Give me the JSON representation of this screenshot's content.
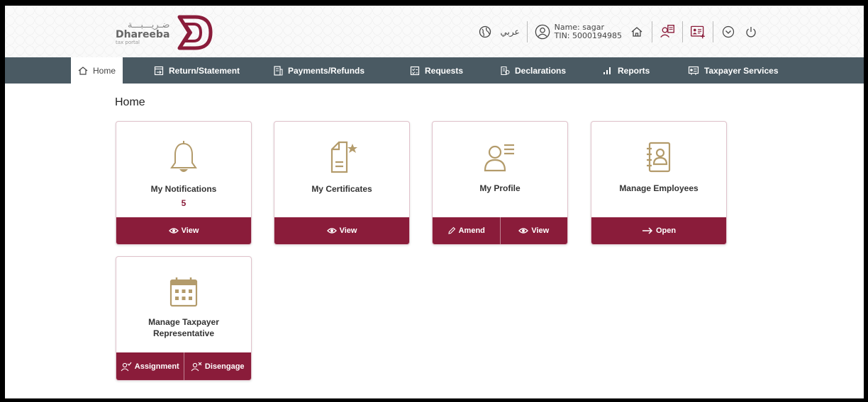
{
  "brand": {
    "arabic_name": "ضـريـــبـــة",
    "name": "Dhareeba",
    "tagline": "tax portal",
    "accent_color": "#8a1c3a"
  },
  "header": {
    "language_label": "عربي",
    "user_name": "Name: sagar",
    "user_tin": "TIN: 5000194985",
    "icons": [
      "globe-icon",
      "user-circle-icon",
      "home-icon",
      "switch-user-icon",
      "id-card-icon",
      "chevron-down-circle-icon",
      "power-icon"
    ]
  },
  "nav": {
    "items": [
      {
        "label": "Home",
        "icon": "home-icon"
      },
      {
        "label": "Return/Statement",
        "icon": "return-icon"
      },
      {
        "label": "Payments/Refunds",
        "icon": "payments-icon"
      },
      {
        "label": "Requests",
        "icon": "requests-icon"
      },
      {
        "label": "Declarations",
        "icon": "declarations-icon"
      },
      {
        "label": "Reports",
        "icon": "reports-icon"
      },
      {
        "label": "Taxpayer Services",
        "icon": "taxpayer-services-icon"
      }
    ]
  },
  "page": {
    "title": "Home"
  },
  "cards": [
    {
      "title": "My Notifications",
      "count": "5",
      "icon": "bell-icon",
      "actions": [
        {
          "label": "View",
          "icon": "eye-icon"
        }
      ]
    },
    {
      "title": "My Certificates",
      "icon": "certificate-icon",
      "actions": [
        {
          "label": "View",
          "icon": "eye-icon"
        }
      ]
    },
    {
      "title": "My Profile",
      "icon": "profile-icon",
      "actions": [
        {
          "label": "Amend",
          "icon": "pencil-icon"
        },
        {
          "label": "View",
          "icon": "eye-icon"
        }
      ]
    },
    {
      "title": "Manage Employees",
      "icon": "address-book-icon",
      "actions": [
        {
          "label": "Open",
          "icon": "arrow-right-icon"
        }
      ]
    },
    {
      "title_line1": "Manage Taxpayer",
      "title_line2": "Representative",
      "icon": "calendar-icon",
      "actions": [
        {
          "label": "Assignment",
          "icon": "user-check-icon"
        },
        {
          "label": "Disengage",
          "icon": "user-x-icon"
        }
      ]
    }
  ]
}
